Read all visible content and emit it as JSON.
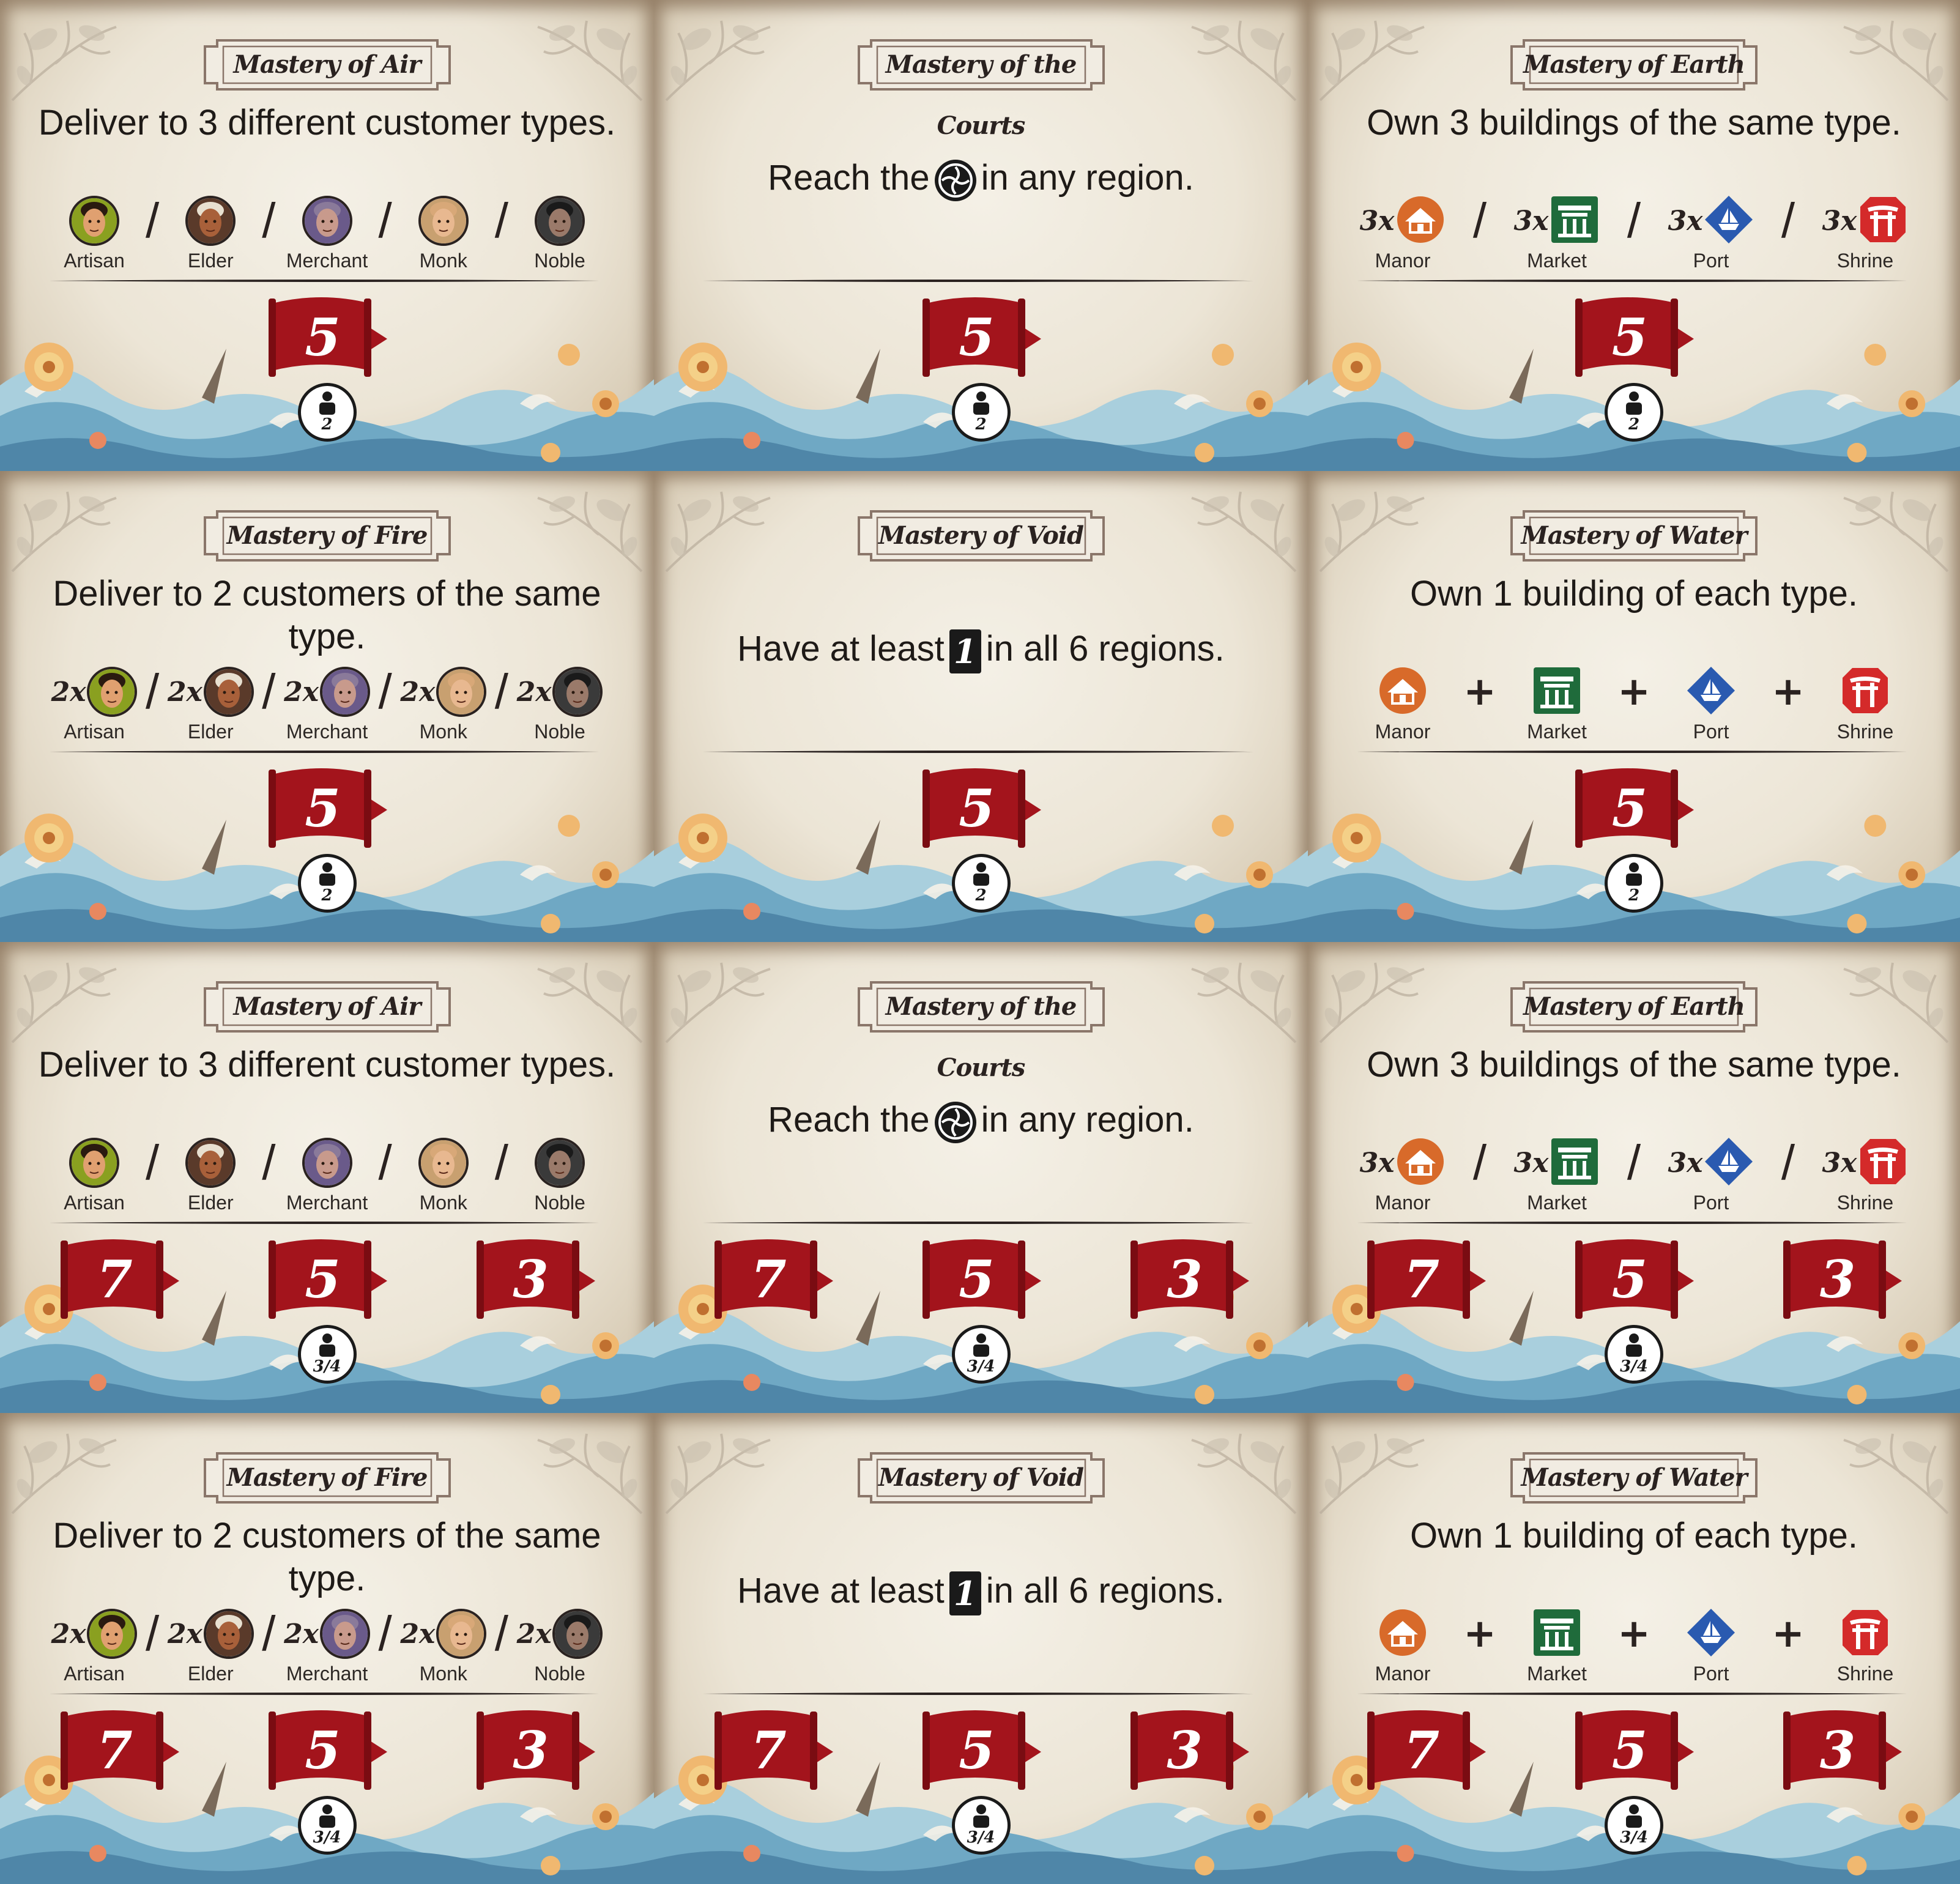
{
  "colors": {
    "flag": "#a3141c",
    "manor": "#d86a2a",
    "market": "#1f6b3b",
    "port": "#2a5ab0",
    "shrine": "#d42a2a"
  },
  "cards": [
    {
      "title": "Mastery of Air",
      "type": "air",
      "text": "Deliver to 3 different customer types.",
      "icons": [
        {
          "label": "Artisan",
          "kind": "artisan"
        },
        {
          "label": "Elder",
          "kind": "elder"
        },
        {
          "label": "Merchant",
          "kind": "merchant"
        },
        {
          "label": "Monk",
          "kind": "monk"
        },
        {
          "label": "Noble",
          "kind": "noble"
        }
      ],
      "separator": "/",
      "multiplier": "",
      "rewards": [
        "5"
      ],
      "players": "2"
    },
    {
      "title": "Mastery of the Courts",
      "type": "courts",
      "text_before": "Reach the",
      "text_after": "in any region.",
      "icon": "emblem-icon",
      "rewards": [
        "5"
      ],
      "players": "2"
    },
    {
      "title": "Mastery of Earth",
      "type": "earth",
      "text": "Own 3 buildings of the same type.",
      "icons": [
        {
          "label": "Manor",
          "kind": "manor"
        },
        {
          "label": "Market",
          "kind": "market"
        },
        {
          "label": "Port",
          "kind": "port"
        },
        {
          "label": "Shrine",
          "kind": "shrine"
        }
      ],
      "separator": "/",
      "multiplier": "3x",
      "rewards": [
        "5"
      ],
      "players": "2"
    },
    {
      "title": "Mastery of Fire",
      "type": "fire",
      "text": "Deliver to 2 customers of the same type.",
      "icons": [
        {
          "label": "Artisan",
          "kind": "artisan"
        },
        {
          "label": "Elder",
          "kind": "elder"
        },
        {
          "label": "Merchant",
          "kind": "merchant"
        },
        {
          "label": "Monk",
          "kind": "monk"
        },
        {
          "label": "Noble",
          "kind": "noble"
        }
      ],
      "separator": "/",
      "multiplier": "2x",
      "rewards": [
        "5"
      ],
      "players": "2"
    },
    {
      "title": "Mastery of Void",
      "type": "void",
      "text_before": "Have at least",
      "text_after": "in all 6 regions.",
      "icon": "influence-token-icon",
      "token": "1",
      "rewards": [
        "5"
      ],
      "players": "2"
    },
    {
      "title": "Mastery of Water",
      "type": "water",
      "text": "Own 1 building of each type.",
      "icons": [
        {
          "label": "Manor",
          "kind": "manor"
        },
        {
          "label": "Market",
          "kind": "market"
        },
        {
          "label": "Port",
          "kind": "port"
        },
        {
          "label": "Shrine",
          "kind": "shrine"
        }
      ],
      "separator": "+",
      "multiplier": "",
      "rewards": [
        "5"
      ],
      "players": "2"
    },
    {
      "title": "Mastery of Air",
      "type": "air",
      "text": "Deliver to 3 different customer types.",
      "icons": [
        {
          "label": "Artisan",
          "kind": "artisan"
        },
        {
          "label": "Elder",
          "kind": "elder"
        },
        {
          "label": "Merchant",
          "kind": "merchant"
        },
        {
          "label": "Monk",
          "kind": "monk"
        },
        {
          "label": "Noble",
          "kind": "noble"
        }
      ],
      "separator": "/",
      "multiplier": "",
      "rewards": [
        "7",
        "5",
        "3"
      ],
      "players": "3/4"
    },
    {
      "title": "Mastery of the Courts",
      "type": "courts",
      "text_before": "Reach the",
      "text_after": "in any region.",
      "icon": "emblem-icon",
      "rewards": [
        "7",
        "5",
        "3"
      ],
      "players": "3/4"
    },
    {
      "title": "Mastery of Earth",
      "type": "earth",
      "text": "Own 3 buildings of the same type.",
      "icons": [
        {
          "label": "Manor",
          "kind": "manor"
        },
        {
          "label": "Market",
          "kind": "market"
        },
        {
          "label": "Port",
          "kind": "port"
        },
        {
          "label": "Shrine",
          "kind": "shrine"
        }
      ],
      "separator": "/",
      "multiplier": "3x",
      "rewards": [
        "7",
        "5",
        "3"
      ],
      "players": "3/4"
    },
    {
      "title": "Mastery of Fire",
      "type": "fire",
      "text": "Deliver to 2 customers of the same type.",
      "icons": [
        {
          "label": "Artisan",
          "kind": "artisan"
        },
        {
          "label": "Elder",
          "kind": "elder"
        },
        {
          "label": "Merchant",
          "kind": "merchant"
        },
        {
          "label": "Monk",
          "kind": "monk"
        },
        {
          "label": "Noble",
          "kind": "noble"
        }
      ],
      "separator": "/",
      "multiplier": "2x",
      "rewards": [
        "7",
        "5",
        "3"
      ],
      "players": "3/4"
    },
    {
      "title": "Mastery of Void",
      "type": "void",
      "text_before": "Have at least",
      "text_after": "in all 6 regions.",
      "icon": "influence-token-icon",
      "token": "1",
      "rewards": [
        "7",
        "5",
        "3"
      ],
      "players": "3/4"
    },
    {
      "title": "Mastery of Water",
      "type": "water",
      "text": "Own 1 building of each type.",
      "icons": [
        {
          "label": "Manor",
          "kind": "manor"
        },
        {
          "label": "Market",
          "kind": "market"
        },
        {
          "label": "Port",
          "kind": "port"
        },
        {
          "label": "Shrine",
          "kind": "shrine"
        }
      ],
      "separator": "+",
      "multiplier": "",
      "rewards": [
        "7",
        "5",
        "3"
      ],
      "players": "3/4"
    }
  ]
}
